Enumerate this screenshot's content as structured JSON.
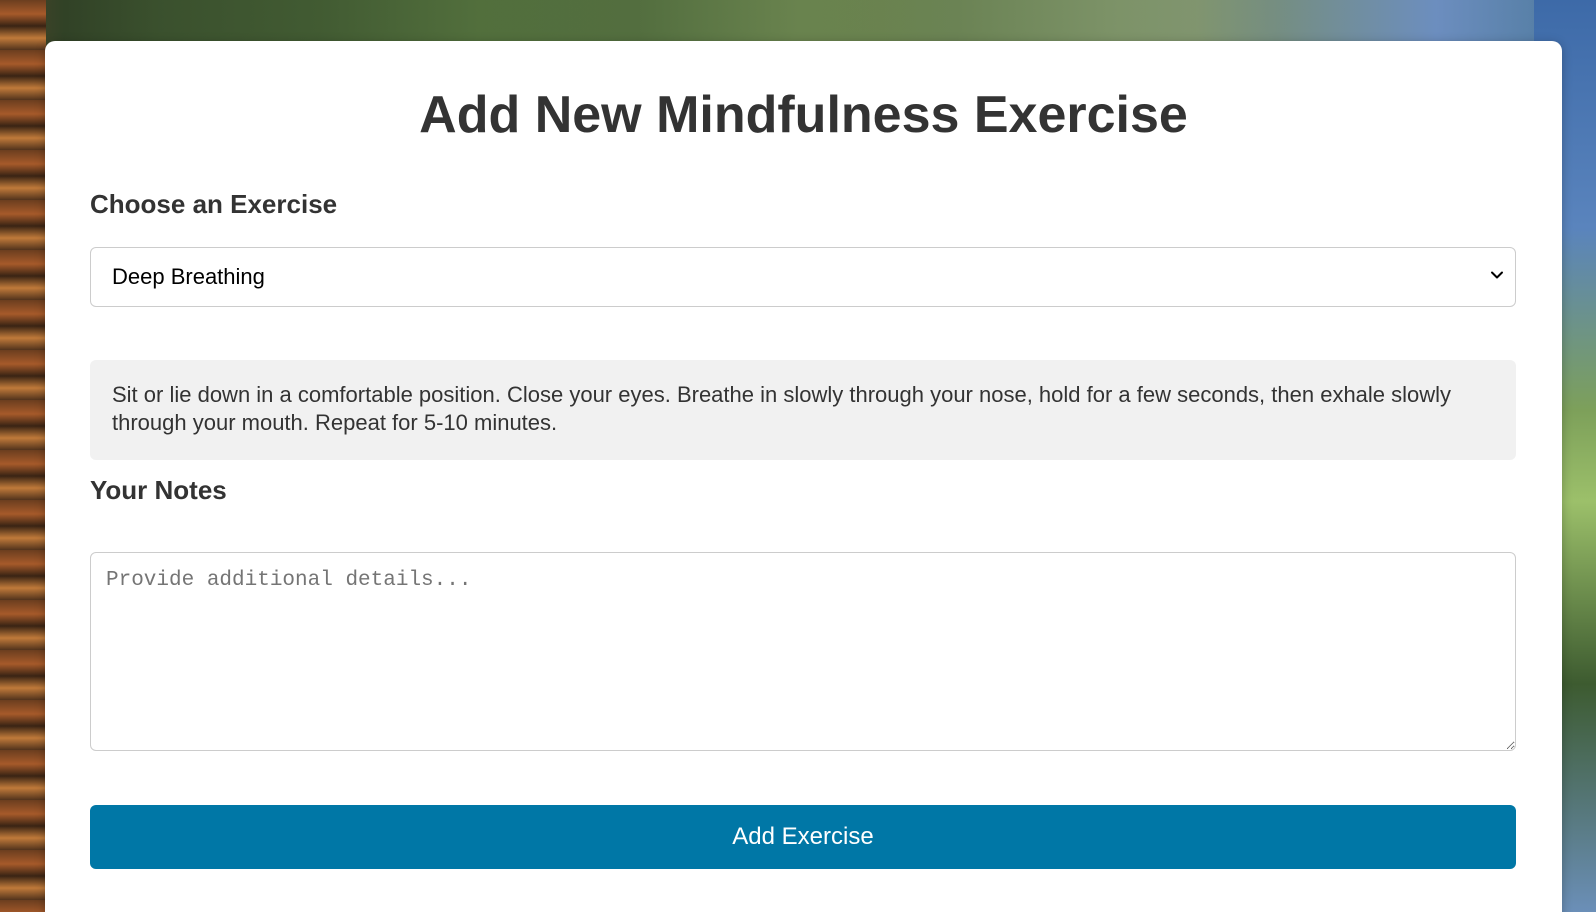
{
  "colors": {
    "card_background": "#ffffff",
    "heading_text": "#333333",
    "description_background": "#f1f1f1",
    "button_background": "#0077a6",
    "button_text": "#ffffff"
  },
  "form": {
    "title": "Add New Mindfulness Exercise",
    "exercise_label": "Choose an Exercise",
    "exercise_select": {
      "selected": "Deep Breathing",
      "icon": "chevron-down-icon"
    },
    "description": "Sit or lie down in a comfortable position. Close your eyes. Breathe in slowly through your nose, hold for a few seconds, then exhale slowly through your mouth. Repeat for 5-10 minutes.",
    "notes_label": "Your Notes",
    "notes_placeholder": "Provide additional details...",
    "notes_value": "",
    "submit_label": "Add Exercise"
  }
}
